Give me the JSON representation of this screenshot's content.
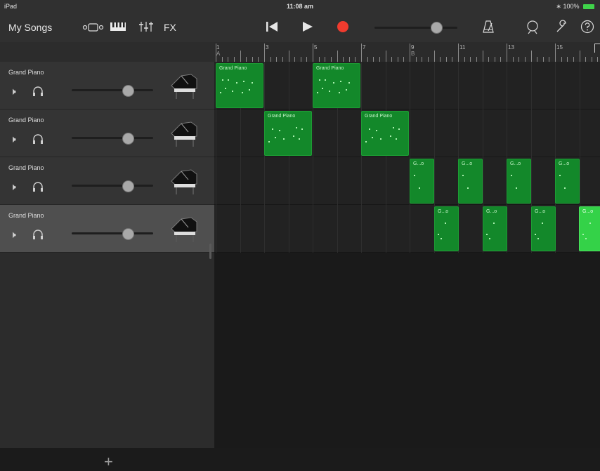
{
  "status_bar": {
    "device": "iPad",
    "time": "11:08 am",
    "battery": "100%"
  },
  "toolbar": {
    "my_songs_label": "My Songs",
    "fx_label": "FX",
    "icons": [
      "browser-icon",
      "keyboard-icon",
      "mixer-icon",
      "go-to-start-icon",
      "play-icon",
      "record-icon",
      "metronome-icon",
      "loop-browser-icon",
      "settings-wrench-icon",
      "help-icon"
    ],
    "record_color": "#f03b2e",
    "master_volume_level": 0.72
  },
  "tracks": [
    {
      "name": "Grand Piano",
      "volume_level": 0.7,
      "selected": false
    },
    {
      "name": "Grand Piano",
      "volume_level": 0.7,
      "selected": false
    },
    {
      "name": "Grand Piano",
      "volume_level": 0.7,
      "selected": false
    },
    {
      "name": "Grand Piano",
      "volume_level": 0.7,
      "selected": true
    }
  ],
  "ruler": {
    "bar_numbers": [
      "1",
      "3",
      "5",
      "7",
      "9",
      "11",
      "13",
      "15"
    ],
    "section_markers": [
      "A",
      "B"
    ]
  },
  "regions": {
    "lane1": [
      "Grand Piano",
      "Grand Piano"
    ],
    "lane2": [
      "Grand Piano",
      "Grand Piano"
    ],
    "lane3": [
      "G...o",
      "G...o",
      "G...o",
      "G...o"
    ],
    "lane4": [
      "G...o",
      "G...o",
      "G...o",
      "G...o"
    ]
  },
  "add_track_label": "+",
  "colors": {
    "region_green": "#13882a",
    "region_selected_green": "#34d248",
    "background": "#1b1b1b"
  }
}
